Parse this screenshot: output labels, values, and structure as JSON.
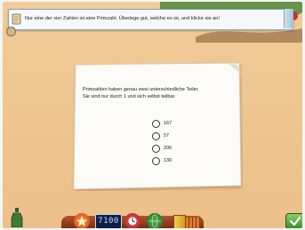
{
  "instruction": {
    "text": "Nur eine der vier Zahlen ist eine Primzahl. Überlege gut, welche es ist, und klicke sie an!"
  },
  "question": {
    "line1": "Primzahlen haben genau zwei unterschiedliche Teiler.",
    "line2": "Sie sind nur durch 1 und sich selbst teilbar."
  },
  "options": [
    {
      "label": "167"
    },
    {
      "label": "57"
    },
    {
      "label": "206"
    },
    {
      "label": "130"
    }
  ],
  "toolbar": {
    "display": "7100"
  },
  "colors": {
    "background": "#eec692",
    "instruction_border": "#7da9c4",
    "toolbar": "#b1542a",
    "confirm": "#3d8e2a"
  },
  "icons": {
    "instruction": "scroll-icon",
    "star": "star-icon",
    "clock": "clock-icon",
    "globe": "globe-icon",
    "book": "book-icon",
    "confirm": "check-icon",
    "bottle": "bottle-icon"
  }
}
